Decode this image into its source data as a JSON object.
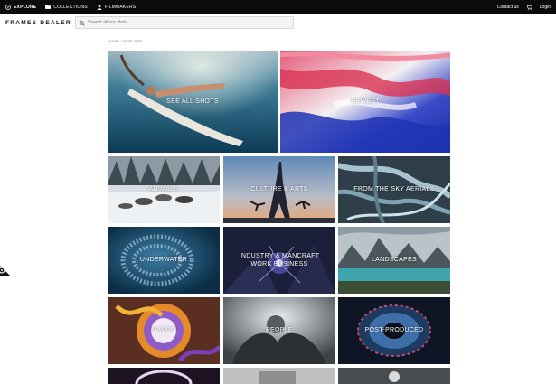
{
  "topbar": {
    "nav": [
      {
        "label": "EXPLORE",
        "icon": "compass-icon"
      },
      {
        "label": "COLLECTIONS",
        "icon": "folder-icon"
      },
      {
        "label": "FILMMAKERS",
        "icon": "user-icon"
      }
    ],
    "contact_label": "Contact us",
    "cart_icon": "cart-icon",
    "login_label": "Login"
  },
  "header": {
    "logo": "FRAMES DEALER",
    "search": {
      "placeholder": "Search all our shots",
      "value": ""
    }
  },
  "breadcrumb": {
    "home": "HOME",
    "separator": " / ",
    "current": "EXPLORE"
  },
  "tiles": [
    {
      "label": "SEE ALL SHOTS",
      "theme": "surf"
    },
    {
      "label": "NEWEST",
      "theme": "paint"
    },
    {
      "label": "ANIMALS",
      "theme": "snow"
    },
    {
      "label": "CULTURE & ARTS",
      "theme": "eiffel"
    },
    {
      "label": "FROM THE SKY AERIALS",
      "theme": "aerial"
    },
    {
      "label": "UNDERWATER",
      "theme": "fish"
    },
    {
      "label": "INDUSTRY & MANCRAFT WORK BUSINESS",
      "theme": "industry"
    },
    {
      "label": "LANDSCAPES",
      "theme": "lake"
    },
    {
      "label": "MACRO",
      "theme": "macro"
    },
    {
      "label": "PEOPLE",
      "theme": "people"
    },
    {
      "label": "POST-PRODUCED",
      "theme": "eye"
    },
    {
      "label": "",
      "theme": "ring"
    },
    {
      "label": "",
      "theme": "grey"
    },
    {
      "label": "",
      "theme": "moto"
    }
  ],
  "settings_icon": "gear-icon"
}
